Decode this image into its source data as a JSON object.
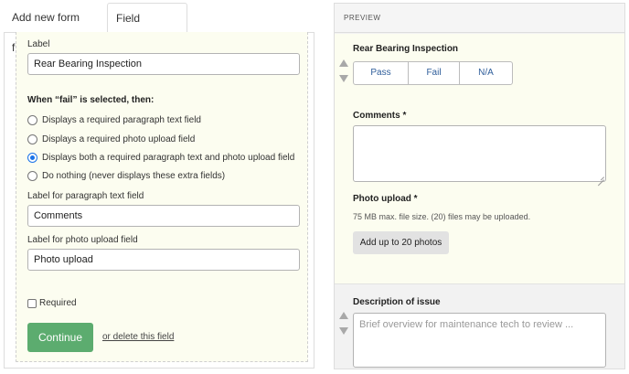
{
  "tabs": {
    "add_fields": "Add new form fields",
    "field_settings": "Field Settings"
  },
  "settings": {
    "label_caption": "Label",
    "label_value": "Rear Bearing Inspection",
    "fail_heading": "When “fail” is selected, then:",
    "options": [
      "Displays a required paragraph text field",
      "Displays a required photo upload field",
      "Displays both a required paragraph text and photo upload field",
      "Do nothing (never displays these extra fields)"
    ],
    "selected_option": 2,
    "paragraph_caption": "Label for paragraph text field",
    "paragraph_value": "Comments",
    "photo_caption": "Label for photo upload field",
    "photo_value": "Photo upload",
    "required_label": "Required",
    "continue_label": "Continue",
    "delete_label": "or delete this field"
  },
  "preview": {
    "title": "PREVIEW",
    "field_title": "Rear Bearing Inspection",
    "segments": [
      "Pass",
      "Fail",
      "N/A"
    ],
    "comments_label": "Comments *",
    "photo_label": "Photo upload *",
    "photo_hint": "75 MB max. file size. (20) files may be uploaded.",
    "upload_button": "Add up to 20 photos",
    "description_label": "Description of issue",
    "description_placeholder": "Brief overview for maintenance tech to review ..."
  },
  "colors": {
    "accent_green": "#5cac6f",
    "panel_bg": "#fcfdf0",
    "link_blue": "#2e5d9a",
    "radio_blue": "#1a73e8"
  }
}
